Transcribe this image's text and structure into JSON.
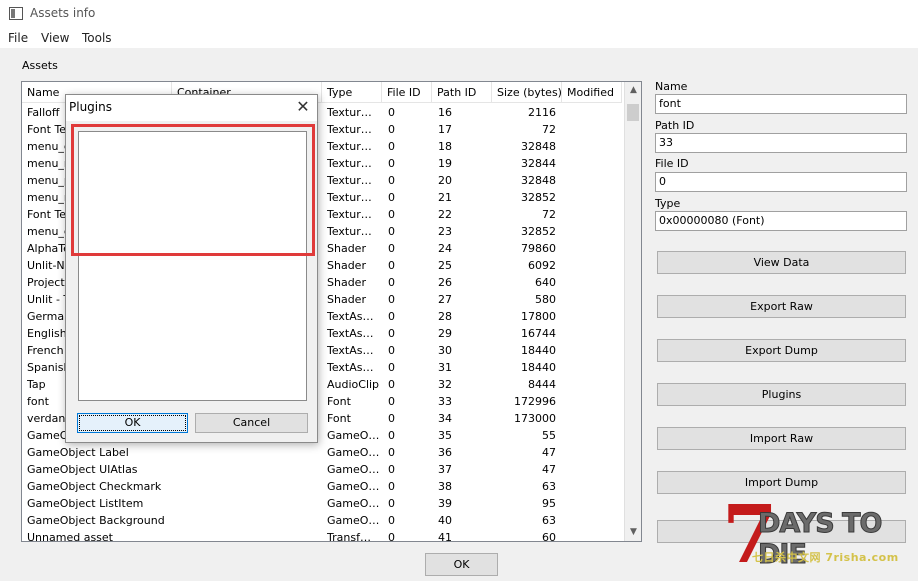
{
  "window": {
    "title": "Assets info"
  },
  "menubar": {
    "items": [
      "File",
      "View",
      "Tools"
    ]
  },
  "assets": {
    "label": "Assets",
    "columns": [
      "Name",
      "Container",
      "Type",
      "File ID",
      "Path ID",
      "Size (bytes)",
      "Modified"
    ],
    "rows": [
      {
        "name": "Falloff",
        "type": "Textur…",
        "file_id": "0",
        "path_id": "16",
        "size": "2116"
      },
      {
        "name": "Font Te",
        "type": "Textur…",
        "file_id": "0",
        "path_id": "17",
        "size": "72"
      },
      {
        "name": "menu_c",
        "type": "Textur…",
        "file_id": "0",
        "path_id": "18",
        "size": "32848"
      },
      {
        "name": "menu_n",
        "type": "Textur…",
        "file_id": "0",
        "path_id": "19",
        "size": "32844"
      },
      {
        "name": "menu_p",
        "type": "Textur…",
        "file_id": "0",
        "path_id": "20",
        "size": "32848"
      },
      {
        "name": "menu_n",
        "type": "Textur…",
        "file_id": "0",
        "path_id": "21",
        "size": "32852"
      },
      {
        "name": "Font Te",
        "type": "Textur…",
        "file_id": "0",
        "path_id": "22",
        "size": "72"
      },
      {
        "name": "menu_c",
        "type": "Textur…",
        "file_id": "0",
        "path_id": "23",
        "size": "32852"
      },
      {
        "name": "AlphaTe",
        "type": "Shader",
        "file_id": "0",
        "path_id": "24",
        "size": "79860"
      },
      {
        "name": "Unlit-No",
        "type": "Shader",
        "file_id": "0",
        "path_id": "25",
        "size": "6092"
      },
      {
        "name": "Projecto",
        "type": "Shader",
        "file_id": "0",
        "path_id": "26",
        "size": "640"
      },
      {
        "name": "Unlit - T",
        "type": "Shader",
        "file_id": "0",
        "path_id": "27",
        "size": "580"
      },
      {
        "name": "German",
        "type": "TextAs…",
        "file_id": "0",
        "path_id": "28",
        "size": "17800"
      },
      {
        "name": "English",
        "type": "TextAs…",
        "file_id": "0",
        "path_id": "29",
        "size": "16744"
      },
      {
        "name": "French",
        "type": "TextAs…",
        "file_id": "0",
        "path_id": "30",
        "size": "18440"
      },
      {
        "name": "Spanish",
        "type": "TextAs…",
        "file_id": "0",
        "path_id": "31",
        "size": "18440"
      },
      {
        "name": "Tap",
        "type": "AudioClip",
        "file_id": "0",
        "path_id": "32",
        "size": "8444"
      },
      {
        "name": "font",
        "type": "Font",
        "file_id": "0",
        "path_id": "33",
        "size": "172996"
      },
      {
        "name": "verdana",
        "type": "Font",
        "file_id": "0",
        "path_id": "34",
        "size": "173000"
      },
      {
        "name": "GameObject",
        "type": "GameO…",
        "file_id": "0",
        "path_id": "35",
        "size": "55"
      },
      {
        "name": "GameObject Label",
        "type": "GameO…",
        "file_id": "0",
        "path_id": "36",
        "size": "47"
      },
      {
        "name": "GameObject UIAtlas",
        "type": "GameO…",
        "file_id": "0",
        "path_id": "37",
        "size": "47"
      },
      {
        "name": "GameObject Checkmark",
        "type": "GameO…",
        "file_id": "0",
        "path_id": "38",
        "size": "63"
      },
      {
        "name": "GameObject ListItem",
        "type": "GameO…",
        "file_id": "0",
        "path_id": "39",
        "size": "95"
      },
      {
        "name": "GameObject Background",
        "type": "GameO…",
        "file_id": "0",
        "path_id": "40",
        "size": "63"
      },
      {
        "name": "Unnamed asset",
        "type": "Transf…",
        "file_id": "0",
        "path_id": "41",
        "size": "60"
      }
    ]
  },
  "details": {
    "name_label": "Name",
    "name_value": "font",
    "path_id_label": "Path ID",
    "path_id_value": "33",
    "file_id_label": "File ID",
    "file_id_value": "0",
    "type_label": "Type",
    "type_value": "0x00000080 (Font)"
  },
  "actions": {
    "view_data": "View Data",
    "export_raw": "Export Raw",
    "export_dump": "Export Dump",
    "plugins": "Plugins",
    "import_raw": "Import Raw",
    "import_dump": "Import Dump",
    "ok": "OK"
  },
  "plugins_dialog": {
    "title": "Plugins",
    "close_glyph": "✕",
    "ok": "OK",
    "cancel": "Cancel",
    "highlight_color": "#e03a3a"
  },
  "scroll": {
    "up_glyph": "▲",
    "down_glyph": "▼"
  },
  "watermark": {
    "seven": "7",
    "title": "DAYS TO DIE",
    "subtitle": "七日杀中文网 7risha.com"
  }
}
